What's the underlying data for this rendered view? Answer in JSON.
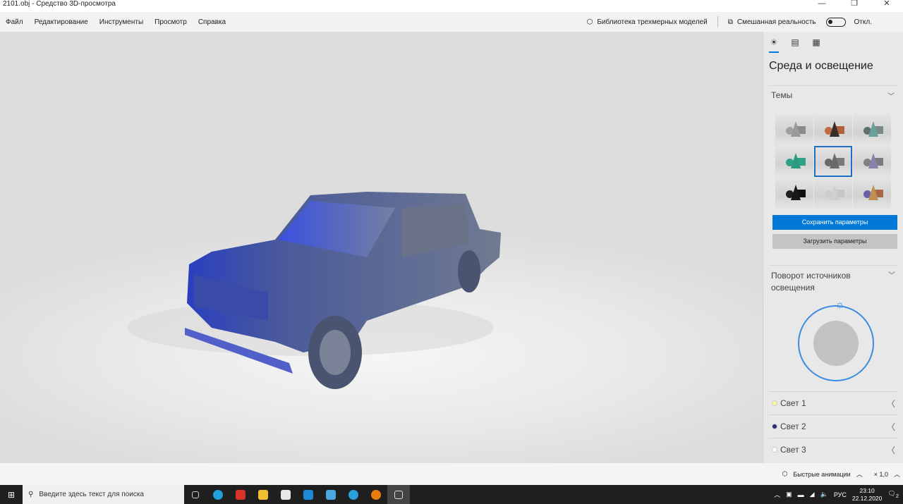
{
  "window": {
    "title": "2101.obj - Средство 3D-просмотра",
    "minimize": "—",
    "maximize": "❐",
    "close": "✕"
  },
  "menu": [
    "Файл",
    "Редактирование",
    "Инструменты",
    "Просмотр",
    "Справка"
  ],
  "toolbar": {
    "library_label": "Библиотека трехмерных моделей",
    "mixed_reality_label": "Смешанная реальность",
    "toggle_state": "Откл."
  },
  "panel": {
    "title": "Среда и освещение",
    "themes_label": "Темы",
    "themes": [
      {
        "cone": "#9a9a9a",
        "box": "#8c8c8c",
        "ball": "#a0a0a0"
      },
      {
        "cone": "#3a2a2a",
        "box": "#b0603a",
        "ball": "#c06a40"
      },
      {
        "cone": "#6aa09a",
        "box": "#7a8a88",
        "ball": "#607070"
      },
      {
        "cone": "#2a9a80",
        "box": "#30a088",
        "ball": "#30a088"
      },
      {
        "cone": "#6a6a6a",
        "box": "#7a7a7a",
        "ball": "#6a6a6a"
      },
      {
        "cone": "#8a80a8",
        "box": "#7a7a80",
        "ball": "#808080"
      },
      {
        "cone": "#181818",
        "box": "#101010",
        "ball": "#202020"
      },
      {
        "cone": "#cfcfcf",
        "box": "#c6c6c6",
        "ball": "#cccccc"
      },
      {
        "cone": "#c09050",
        "box": "#a86848",
        "ball": "#6a60a8"
      }
    ],
    "selected_theme": 4,
    "save_label": "Сохранить параметры",
    "load_label": "Загрузить параметры",
    "rotation_label": "Поворот источников освещения",
    "lights": [
      {
        "label": "Свет 1",
        "color": "#f8f4a0"
      },
      {
        "label": "Свет 2",
        "color": "#2a2a78"
      },
      {
        "label": "Свет 3",
        "color": "#ffffff"
      }
    ]
  },
  "status": {
    "animations_label": "Быстрые анимации",
    "speed": "× 1,0"
  },
  "taskbar": {
    "search_placeholder": "Введите здесь текст для поиска",
    "lang": "РУС",
    "time": "23:10",
    "date": "22.12.2020",
    "notifications": "2"
  }
}
